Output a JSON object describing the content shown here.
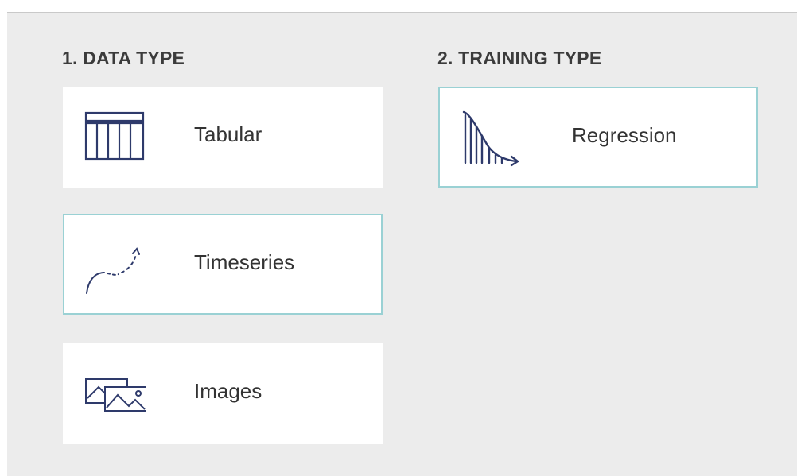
{
  "data_type": {
    "title": "1. DATA TYPE",
    "options": [
      {
        "label": "Tabular",
        "icon": "table-icon",
        "selected": false
      },
      {
        "label": "Timeseries",
        "icon": "trend-curve-icon",
        "selected": true
      },
      {
        "label": "Images",
        "icon": "images-icon",
        "selected": false
      }
    ]
  },
  "training_type": {
    "title": "2. TRAINING TYPE",
    "options": [
      {
        "label": "Regression",
        "icon": "regression-icon",
        "selected": true
      }
    ]
  },
  "colors": {
    "panel_bg": "#ececec",
    "card_bg": "#ffffff",
    "selected_border": "#9ad1d4",
    "icon_color": "#2e3a6b",
    "text": "#333333"
  }
}
